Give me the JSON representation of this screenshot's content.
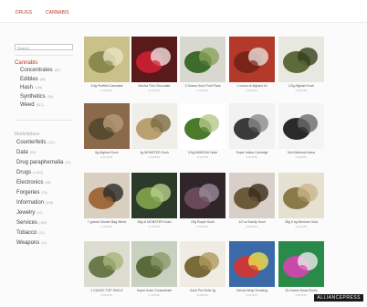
{
  "topbar": {
    "left_link": "DRUGS",
    "right_link": "CANNABIS"
  },
  "sidebar": {
    "search_placeholder": "Search",
    "category_heading": "Cannabis",
    "cannabis_items": [
      {
        "label": "Concentrates",
        "count": "(87)"
      },
      {
        "label": "Edibles",
        "count": "(66)"
      },
      {
        "label": "Hash",
        "count": "(145)"
      },
      {
        "label": "Synthetics",
        "count": "(38)"
      },
      {
        "label": "Weed",
        "count": "(812)"
      }
    ],
    "other_heading": "Marketplace",
    "other_items": [
      {
        "label": "Counterfeits",
        "count": "(111)"
      },
      {
        "label": "Data",
        "count": "(89)"
      },
      {
        "label": "Drug paraphernalia",
        "count": "(42)"
      },
      {
        "label": "Drugs",
        "count": "(1,643)"
      },
      {
        "label": "Electronics",
        "count": "(38)"
      },
      {
        "label": "Forgeries",
        "count": "(76)"
      },
      {
        "label": "Information",
        "count": "(245)"
      },
      {
        "label": "Jewelry",
        "count": "(31)"
      },
      {
        "label": "Services",
        "count": "(155)"
      },
      {
        "label": "Tobacco",
        "count": "(21)"
      },
      {
        "label": "Weapons",
        "count": "(11)"
      }
    ]
  },
  "listings": [
    {
      "title": "1/4g Purified Cannabis",
      "price": "0.30 BTC"
    },
    {
      "title": "Mocha Thin Chocolate",
      "price": "0.12 BTC"
    },
    {
      "title": "3 Grams Kush Fruit Pack",
      "price": "0.19 BTC"
    },
    {
      "title": "1 ounce of Afghani #1",
      "price": "0.85 BTC"
    },
    {
      "title": "1/2g Afghani Kush",
      "price": "0.05 BTC"
    },
    {
      "title": "5g Afghani Kush",
      "price": "0.21 BTC"
    },
    {
      "title": "1g MONSTER Kush",
      "price": "0.04 BTC"
    },
    {
      "title": "3.5g AMNESIA Haze",
      "price": "0.11 BTC"
    },
    {
      "title": "Super Indica Cartridge",
      "price": "0.26 BTC"
    },
    {
      "title": "Mini Medical Indica",
      "price": "0.09 BTC"
    },
    {
      "title": "7 grams Grinder Bag Weed",
      "price": "0.32 BTC"
    },
    {
      "title": "28g of MONSTER Kush",
      "price": "0.71 BTC"
    },
    {
      "title": "20g Purple Kush",
      "price": "0.52 BTC"
    },
    {
      "title": "1/2 oz Kandy Kush",
      "price": "0.40 BTC"
    },
    {
      "title": "28g 5 kg Mexican Gold",
      "price": "0.44 BTC"
    },
    {
      "title": "1 OUNCE TOP SHELF",
      "price": "0.66 BTC"
    },
    {
      "title": "Super Kush Concentrate",
      "price": "0.18 BTC"
    },
    {
      "title": "Kush Pre-Rolls 3g",
      "price": "0.08 BTC"
    },
    {
      "title": "Herbal Wrap Smoking",
      "price": "0.02 BTC"
    },
    {
      "title": "28 Grams Head Exotic",
      "price": "0.59 BTC"
    }
  ],
  "watermark": "ALLIANCEPRESS",
  "colors": {
    "accent": "#c0392b"
  }
}
